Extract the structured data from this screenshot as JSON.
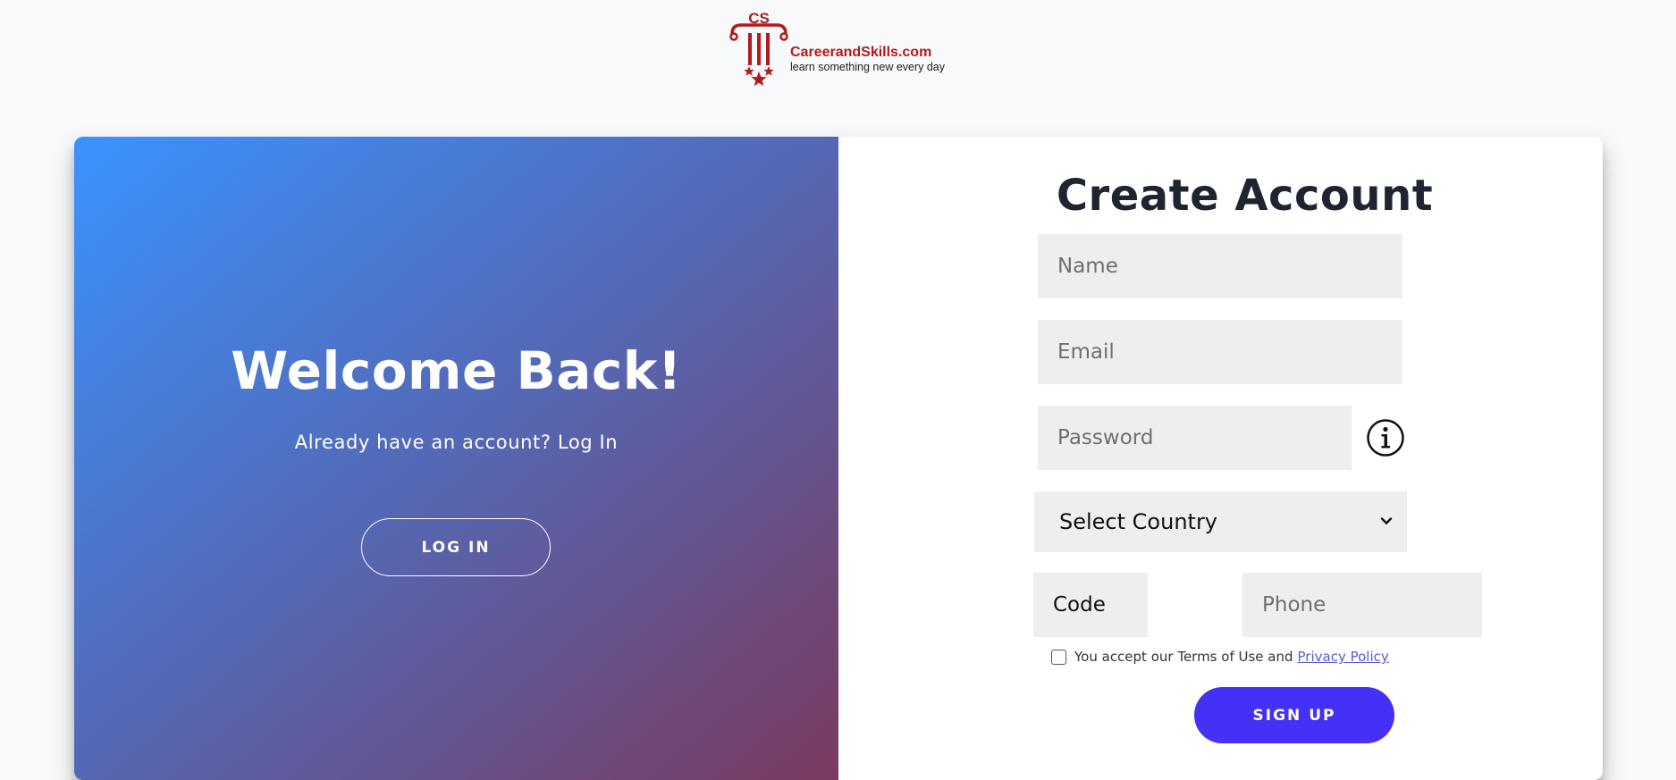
{
  "header": {
    "logo": {
      "mark_text": "CS",
      "name": "CareerandSkills.com",
      "tagline": "learn something new every day",
      "brand_color": "#b01b1b"
    }
  },
  "overlay": {
    "title": "Welcome Back!",
    "text": "Already have an account? Log In",
    "login_label": "LOG IN",
    "gradient_colors": [
      "#3a93ff",
      "#5567b3",
      "#7a3a5e"
    ]
  },
  "form": {
    "title": "Create Account",
    "name_placeholder": "Name",
    "email_placeholder": "Email",
    "password_placeholder": "Password",
    "info_icon": "info-circle-icon",
    "country_select": {
      "selected": "Select Country",
      "icon": "chevron-down-icon"
    },
    "code_value": "Code",
    "phone_placeholder": "Phone",
    "terms": {
      "text": "You accept our Terms of Use and",
      "link_text": "Privacy Policy",
      "checked": false
    },
    "signup_label": "SIGN UP",
    "accent_color": "#4430f6"
  }
}
